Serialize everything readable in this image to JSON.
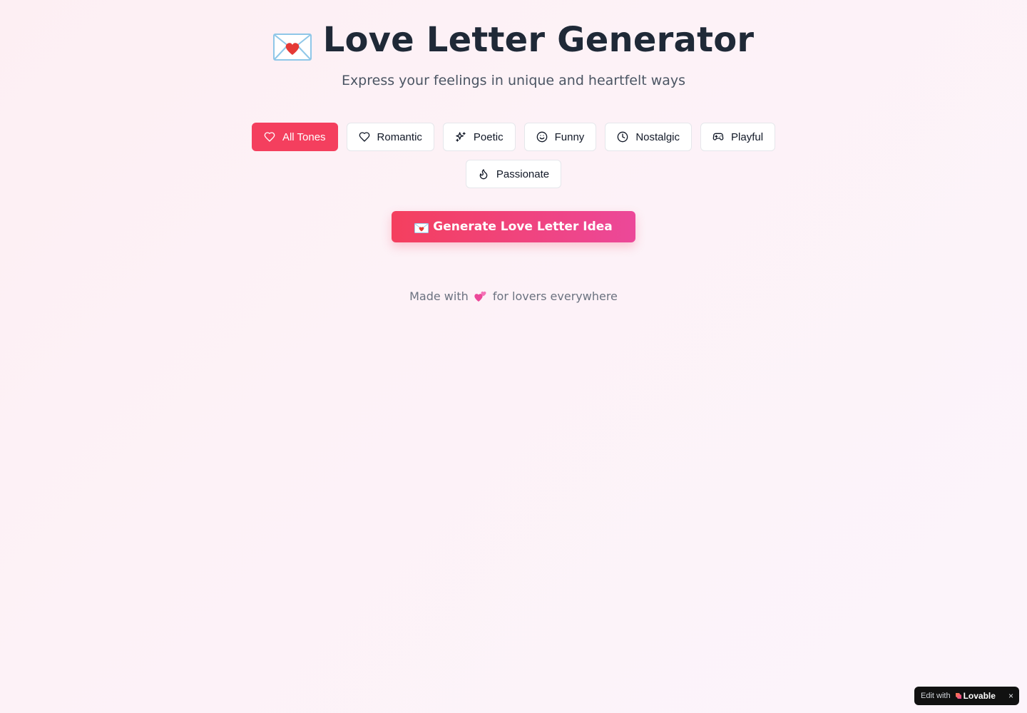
{
  "header": {
    "title": "Love Letter Generator",
    "subtitle": "Express your feelings in unique and heartfelt ways",
    "title_icon": "love-letter-envelope-icon"
  },
  "tones": {
    "selected": "All Tones",
    "items": [
      {
        "label": "All Tones",
        "icon": "heart-icon",
        "active": true
      },
      {
        "label": "Romantic",
        "icon": "heart-icon",
        "active": false
      },
      {
        "label": "Poetic",
        "icon": "sparkles-icon",
        "active": false
      },
      {
        "label": "Funny",
        "icon": "smile-icon",
        "active": false
      },
      {
        "label": "Nostalgic",
        "icon": "clock-icon",
        "active": false
      },
      {
        "label": "Playful",
        "icon": "gamepad-icon",
        "active": false
      },
      {
        "label": "Passionate",
        "icon": "flame-icon",
        "active": false
      }
    ]
  },
  "generate": {
    "label": "Generate Love Letter Idea",
    "icon": "love-letter-envelope-icon"
  },
  "footer": {
    "prefix": "Made with",
    "suffix": "for lovers everywhere",
    "icon": "two-hearts-icon"
  },
  "badge": {
    "edit_label": "Edit with",
    "brand": "Lovable",
    "close": "×"
  },
  "colors": {
    "accent": "#f43f5e",
    "accent_end": "#ec4899",
    "title": "#1f2937",
    "muted": "#4b5563"
  }
}
